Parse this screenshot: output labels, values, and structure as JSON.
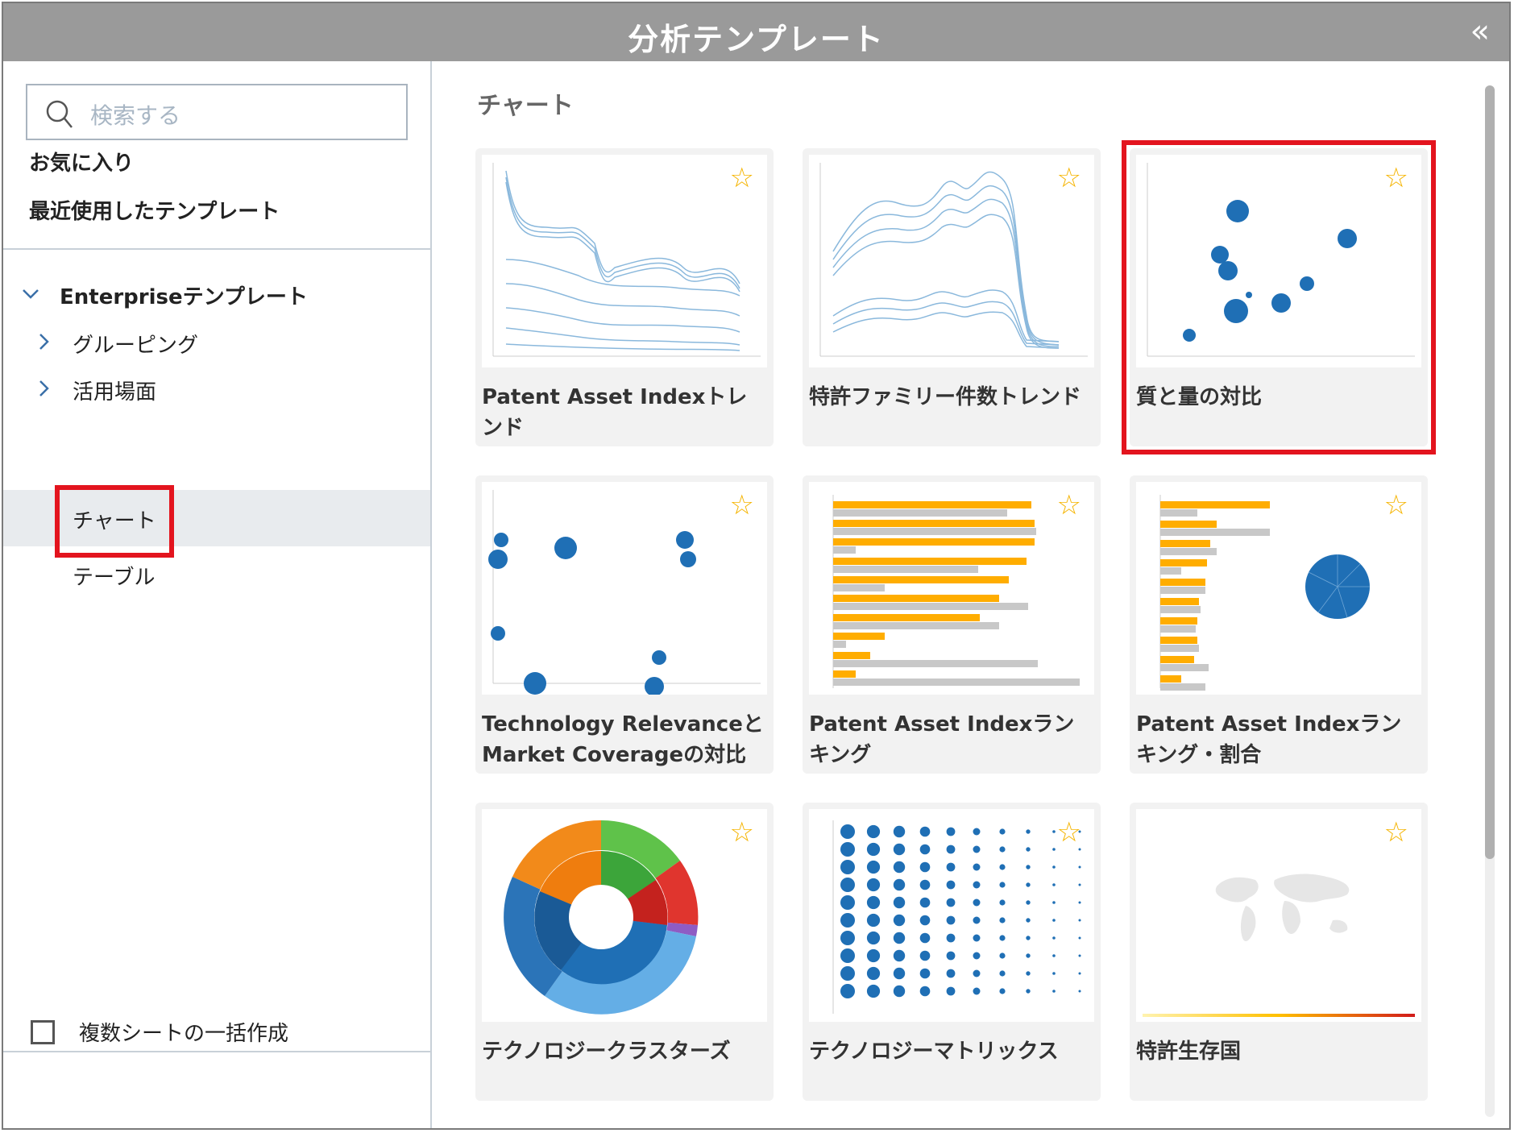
{
  "window": {
    "title": "分析テンプレート",
    "collapse_icon": "double-chevron-left-icon"
  },
  "sidebar": {
    "search": {
      "placeholder": "検索する",
      "icon": "search-icon"
    },
    "links": [
      {
        "label": "お気に入り"
      },
      {
        "label": "最近使用したテンプレート"
      }
    ],
    "tree": {
      "root": {
        "label": "Enterpriseテンプレート",
        "expanded": true
      },
      "items": [
        {
          "label": "グルーピング",
          "expandable": true
        },
        {
          "label": "活用場面",
          "expandable": true
        },
        {
          "label": "チャート",
          "selected": true
        },
        {
          "label": "テーブル"
        }
      ]
    },
    "footer": {
      "checkbox_label": "複数シートの一括作成",
      "checked": false
    }
  },
  "main": {
    "section_title": "チャート",
    "cards": [
      {
        "label": "Patent Asset Indexトレンド",
        "thumb": "multi-line-trend"
      },
      {
        "label": "特許ファミリー件数トレンド",
        "thumb": "multi-line-peaks"
      },
      {
        "label": "質と量の対比",
        "thumb": "bubble-scatter",
        "highlighted": true
      },
      {
        "label": "Technology RelevanceとMarket Coverageの対比",
        "thumb": "bubble-scatter-sparse"
      },
      {
        "label": "Patent Asset Indexランキング",
        "thumb": "horizontal-bars"
      },
      {
        "label": "Patent Asset Indexランキング・割合",
        "thumb": "bars-and-pie"
      },
      {
        "label": "テクノロジークラスターズ",
        "thumb": "sunburst"
      },
      {
        "label": "テクノロジーマトリックス",
        "thumb": "dot-matrix"
      },
      {
        "label": "特許生存国",
        "thumb": "world-map"
      }
    ],
    "star_icon": "star-outline-icon",
    "colors": {
      "accent": "#e3141e",
      "star": "#f5b400",
      "bar_orange": "#ffad00",
      "bar_gray": "#c8c8c8",
      "bubble": "#1f6fb5",
      "line": "#8ab8dc"
    }
  }
}
